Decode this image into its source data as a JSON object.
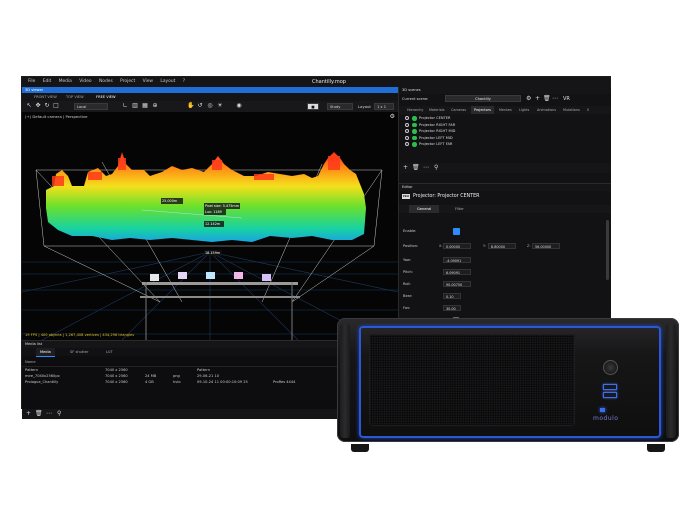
{
  "app": {
    "window_title": "Chantilly.mop",
    "menu": [
      "File",
      "Edit",
      "Media",
      "Video",
      "Nodes",
      "Project",
      "View",
      "Layout",
      "?"
    ]
  },
  "viewport_panel": {
    "header": "3D viewer",
    "tabs": [
      "FRONT VIEW",
      "TOP VIEW",
      "FREE VIEW"
    ],
    "active_tab": "FREE VIEW",
    "toolbar": {
      "coord_mode": "Local",
      "render_mode": "Study",
      "layout_label": "Layout",
      "layout_value": "1 x 1"
    },
    "camera_label": "(+) Default camera | Perspective",
    "annotations": {
      "dist_a": "25.000m",
      "dist_b": "12.142m",
      "dist_c": "18.159m",
      "pixel_size": "Pixel size: 5.475mm",
      "lux": "Lux: 1189"
    },
    "stats": "19 FPS | 400 objects | 1,267,408 vertices | 434,296 triangles"
  },
  "media_list": {
    "header": "Media list",
    "tabs": [
      "Media",
      "SF shutter",
      "LUT"
    ],
    "active_tab": "Media",
    "columns": [
      "Name",
      "",
      "",
      "",
      "",
      ""
    ],
    "rows": [
      {
        "name": "Pattern",
        "res": "7040 x 2560",
        "size": "",
        "type": "",
        "date": "Pattern",
        "extra": ""
      },
      {
        "name": "mire_7040x2560px",
        "res": "7040 x 2560",
        "size": "24 MB",
        "type": "png",
        "date": "29-06-21 10",
        "extra": ""
      },
      {
        "name": "Prologue_Chantilly",
        "res": "7040 x 2560",
        "size": "4 GB",
        "type": "hvio",
        "date": "09-10-24 11 00:00:10:09 25",
        "extra": "ProRes 4444"
      }
    ]
  },
  "scenes_panel": {
    "header": "3D scenes",
    "current_scene_label": "Current scene:",
    "current_scene": "Chantilly",
    "vr_label": "VR",
    "tabs": [
      "Hierarchy",
      "Materials",
      "Cameras",
      "Projectors",
      "Meshes",
      "Lights",
      "Animations",
      "Mutations",
      "S"
    ],
    "active_tab": "Projectors",
    "projectors": [
      "Projector CENTER",
      "Projector RIGHT FAR",
      "Projector RIGHT MID",
      "Projector LEFT MID",
      "Projector LEFT FAR"
    ]
  },
  "editor": {
    "header": "Editor",
    "title": "Projector: Projector CENTER",
    "logo": "ISO",
    "tabs": [
      "General",
      "Filter"
    ],
    "active_tab": "General",
    "props": {
      "enable": "Enable:",
      "position": "Position:",
      "pos_x": "0.00000",
      "pos_y": "8.80000",
      "pos_z": "56.00000",
      "yaw": "Yaw:",
      "yaw_val": "-4.09091",
      "pitch": "Pitch:",
      "pitch_val": "6.09091",
      "roll": "Roll:",
      "roll_val": "90.00750",
      "bear": "Bear:",
      "bear_val": "0.10",
      "fov": "Fov:",
      "fov_val": "30.00",
      "pin_target": "Pin target:"
    }
  },
  "device": {
    "brand": "modulo"
  },
  "colors": {
    "accent": "#2f8cff",
    "device_led": "#2a58d6"
  }
}
